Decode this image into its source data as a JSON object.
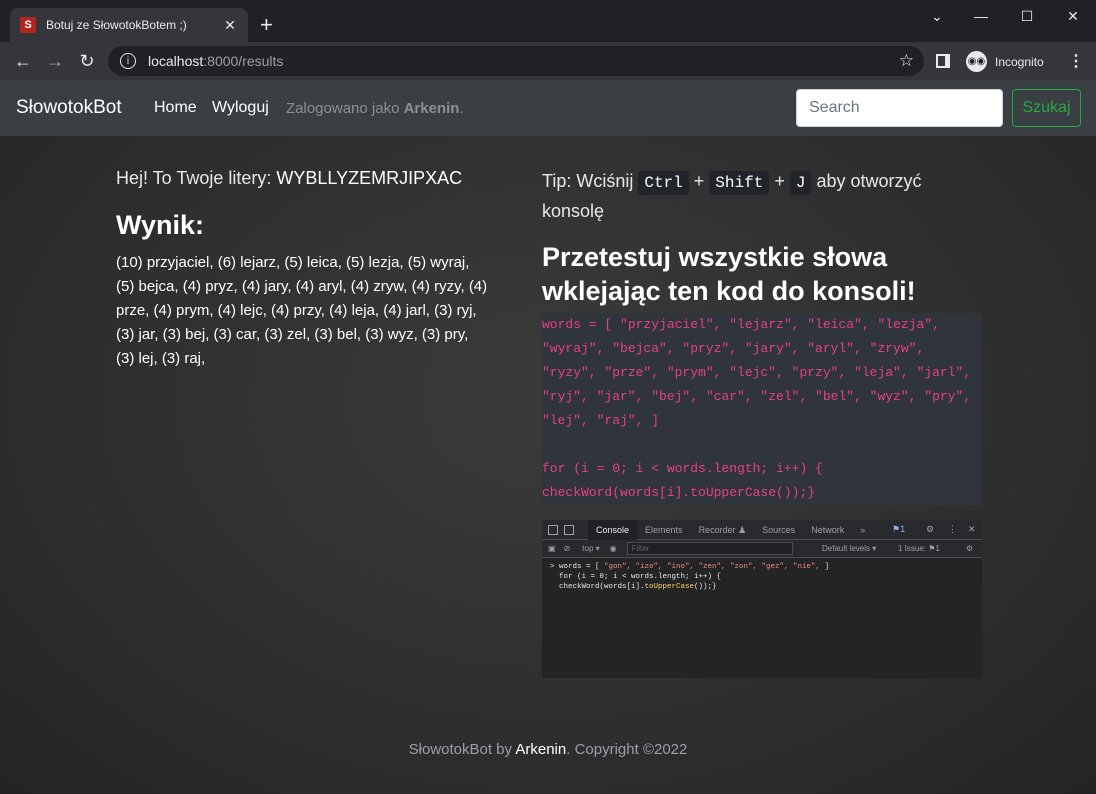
{
  "browser": {
    "tab_title": "Botuj ze SłowotokBotem ;)",
    "favicon_letter": "S",
    "url_host": "localhost",
    "url_path": ":8000/results",
    "incognito_label": "Incognito"
  },
  "navbar": {
    "brand": "SłowotokBot",
    "links": [
      "Home",
      "Wyloguj"
    ],
    "logged_prefix": "Zalogowano jako ",
    "username": "Arkenin",
    "logged_suffix": ".",
    "search_placeholder": "Search",
    "search_button": "Szukaj"
  },
  "left": {
    "greeting": "Hej! To Twoje litery: ",
    "letters": "WYBLLYZEMRJIPXAC",
    "result_heading": "Wynik:",
    "words": "(10) przyjaciel, (6) lejarz, (5) leica, (5) lezja, (5) wyraj, (5) bejca, (4) pryz, (4) jary, (4) aryl, (4) zryw, (4) ryzy, (4) prze, (4) prym, (4) lejc, (4) przy, (4) leja, (4) jarl, (3) ryj, (3) jar, (3) bej, (3) car, (3) zel, (3) bel, (3) wyz, (3) pry, (3) lej, (3) raj,"
  },
  "right": {
    "tip_prefix": "Tip: Wciśnij ",
    "keys": [
      "Ctrl",
      "Shift",
      "J"
    ],
    "plus": "+",
    "tip_suffix": " aby otworzyć konsolę",
    "test_heading": "Przetestuj wszystkie słowa wklejając ten kod do konsoli!",
    "code": "words = [ \"przyjaciel\", \"lejarz\", \"leica\", \"lezja\", \"wyraj\", \"bejca\", \"pryz\", \"jary\", \"aryl\", \"zryw\", \"ryzy\", \"prze\", \"prym\", \"lejc\", \"przy\", \"leja\", \"jarl\", \"ryj\", \"jar\", \"bej\", \"car\", \"zel\", \"bel\", \"wyz\", \"pry\", \"lej\", \"raj\", ]\n\nfor (i = 0; i < words.length; i++) {\ncheckWord(words[i].toUpperCase());}"
  },
  "devtools": {
    "tabs": [
      "Console",
      "Elements",
      "Recorder ♟",
      "Sources",
      "Network",
      "»"
    ],
    "context": "top ▾",
    "filter_placeholder": "Filter",
    "levels": "Default levels ▾",
    "issues": "1 Issue: ⚑1",
    "badge": "⚑1",
    "line1_prefix": "> words = [ ",
    "line1_words": "\"gon\", \"izo\", \"ino\", \"zen\", \"zon\", \"gez\", \"nie\",",
    "line1_suffix": " ]",
    "line2": "  for (i = 0; i < words.length; i++) {",
    "line3_prefix": "  checkWord(words[i].",
    "line3_method": "toUpperCase",
    "line3_suffix": "());}"
  },
  "footer": {
    "prefix": "SłowotokBot by ",
    "author": "Arkenin",
    "suffix": ". Copyright ©2022"
  }
}
